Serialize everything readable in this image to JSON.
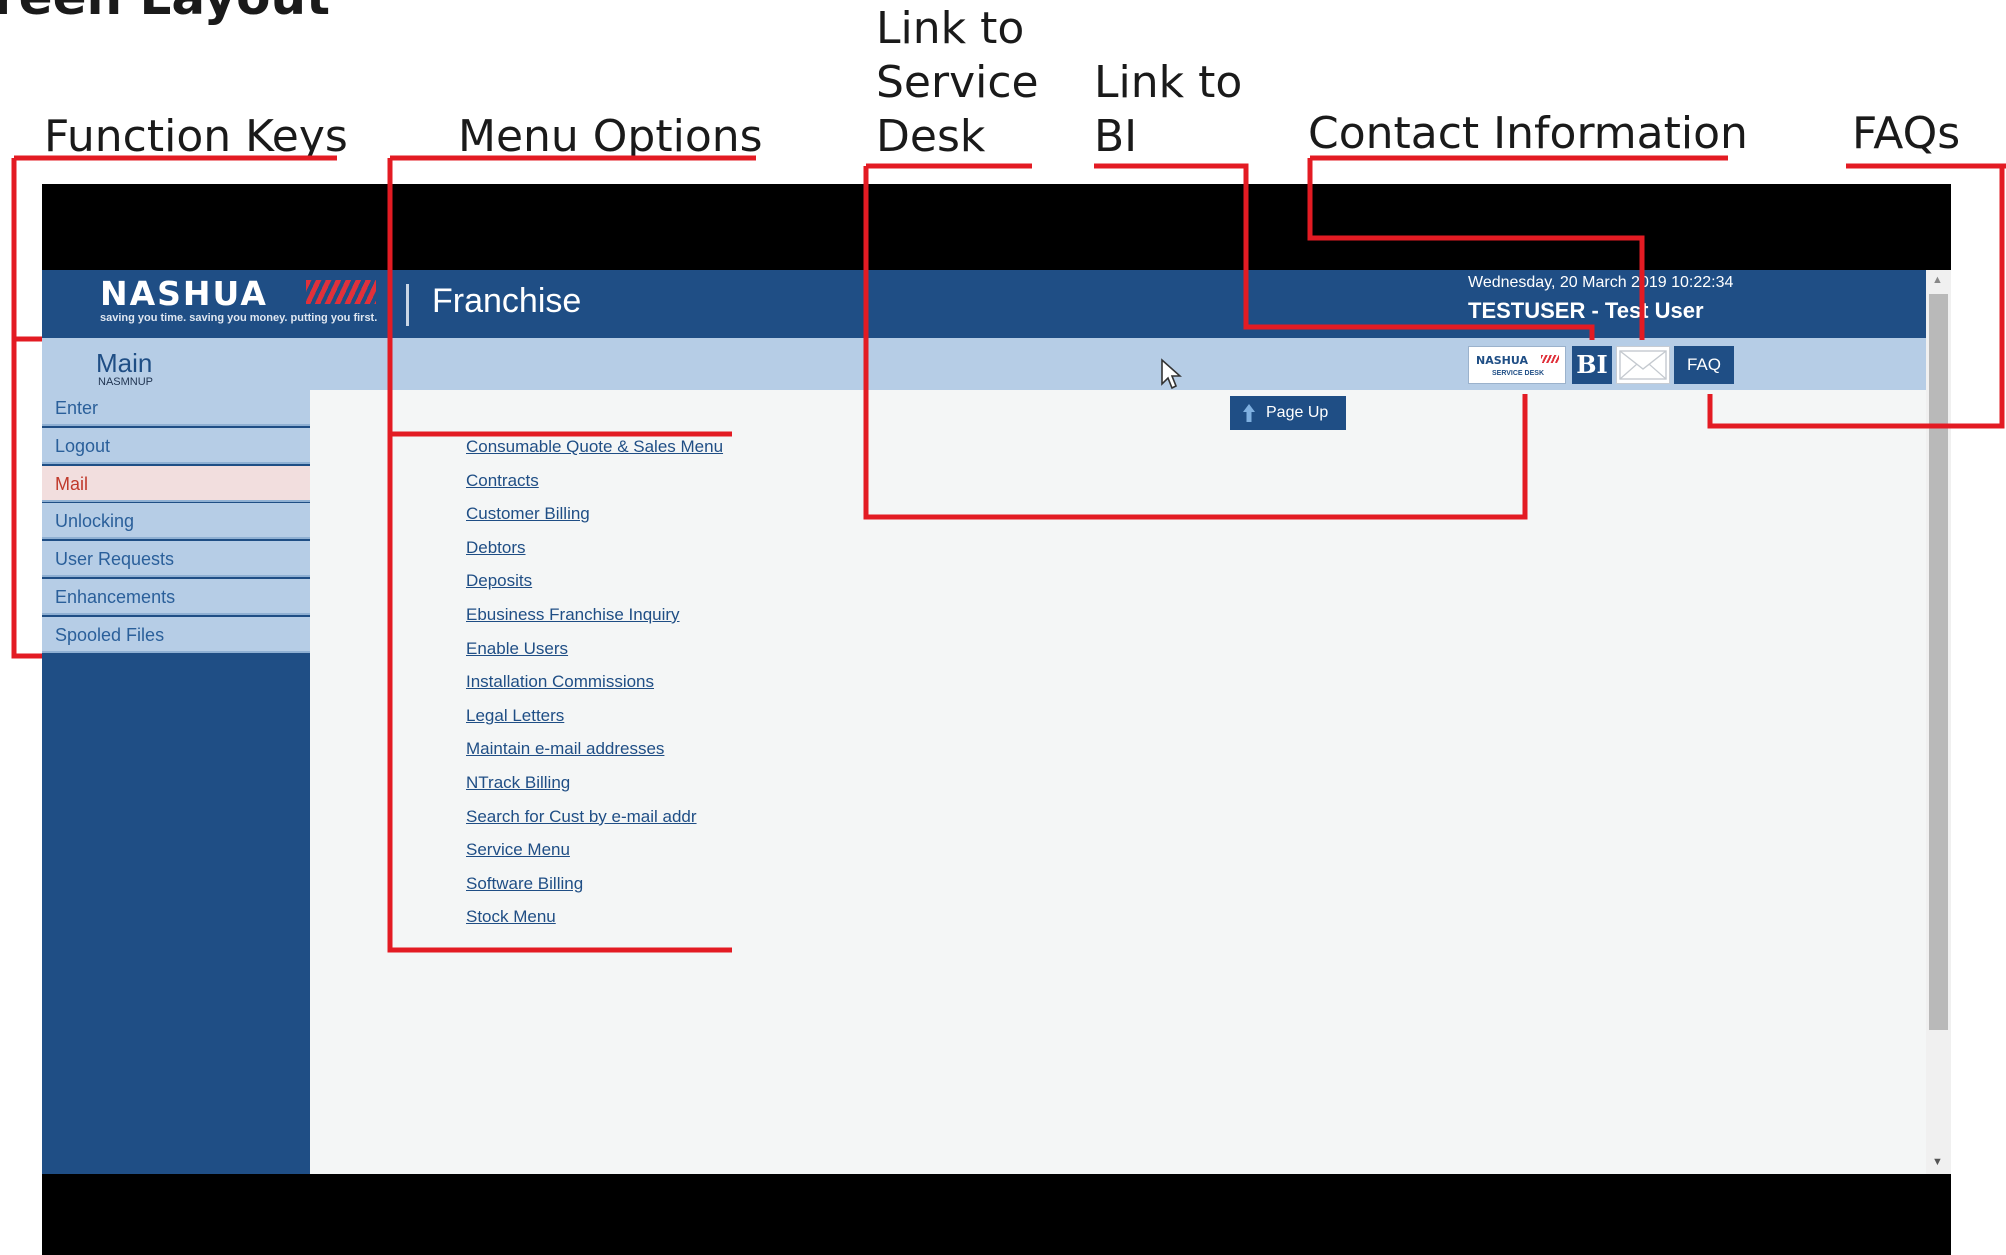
{
  "annotations": {
    "slide_title_partial": "reen Layout",
    "function_keys": "Function Keys",
    "menu_options": "Menu Options",
    "service_desk_line1": "Link to",
    "service_desk_line2": "Service",
    "service_desk_line3": "Desk",
    "bi_line1": "Link to",
    "bi_line2": "BI",
    "contact_information": "Contact Information",
    "faqs": "FAQs",
    "callout_color": "#e31b23"
  },
  "header": {
    "logo_text": "NASHUA",
    "tagline": "saving you time. saving you money. putting you first.",
    "app_title": "Franchise",
    "datetime": "Wednesday, 20 March 2019 10:22:34",
    "user": "TESTUSER - Test User",
    "bg_color": "#1f4e85"
  },
  "subheader": {
    "title": "Main",
    "code": "NASMNUP"
  },
  "toolbar": {
    "service_desk_logo": "NASHUA",
    "service_desk_sub": "SERVICE DESK",
    "bi_label": "BI",
    "mail_icon": "envelope-icon",
    "faq_label": "FAQ"
  },
  "function_keys": [
    {
      "label": "Enter"
    },
    {
      "label": "Logout"
    },
    {
      "label": "Mail",
      "active": true
    },
    {
      "label": "Unlocking"
    },
    {
      "label": "User Requests"
    },
    {
      "label": "Enhancements"
    },
    {
      "label": "Spooled Files"
    }
  ],
  "page_up_label": "Page Up",
  "menu_options": [
    "Consumable Quote & Sales Menu",
    "Contracts",
    "Customer Billing",
    "Debtors",
    "Deposits",
    "Ebusiness Franchise Inquiry",
    "Enable Users",
    "Installation Commissions",
    "Legal Letters",
    "Maintain e-mail addresses",
    "NTrack Billing",
    "Search for Cust by e-mail addr",
    "Service Menu",
    "Software Billing",
    "Stock Menu"
  ]
}
